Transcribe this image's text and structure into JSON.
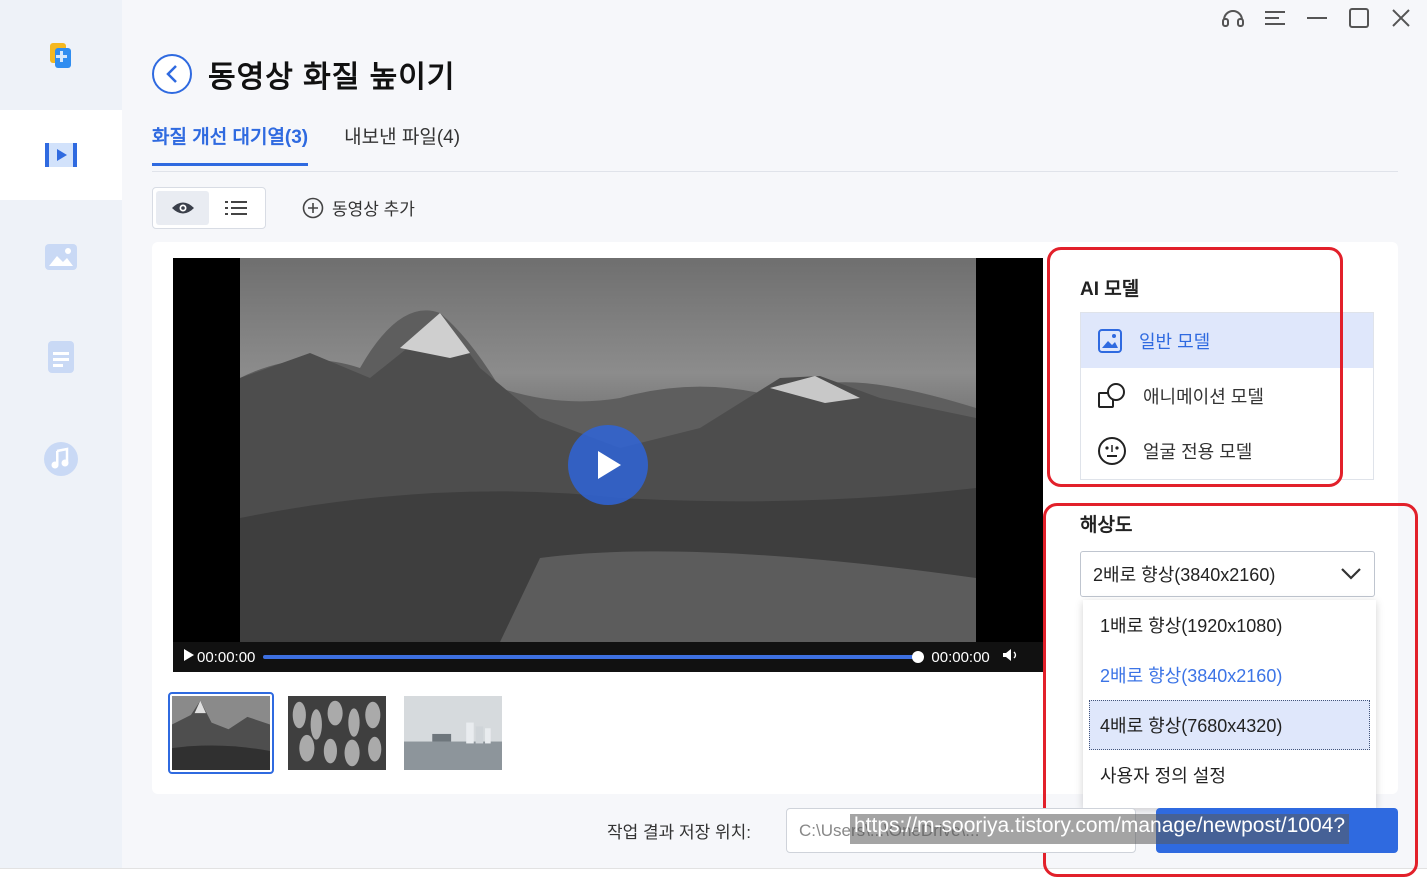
{
  "page": {
    "title": "동영상 화질 높이기"
  },
  "tabs": [
    {
      "label": "화질 개선 대기열(3)"
    },
    {
      "label": "내보낸 파일(4)"
    }
  ],
  "toolbar": {
    "add_video_label": "동영상 추가"
  },
  "video": {
    "current_time": "00:00:00",
    "duration": "00:00:00",
    "progress": 1.0
  },
  "ai_model": {
    "label": "AI 모델",
    "options": [
      {
        "label": "일반 모델",
        "icon": "image-icon",
        "selected": true
      },
      {
        "label": "애니메이션 모델",
        "icon": "shapes-icon",
        "selected": false
      },
      {
        "label": "얼굴 전용 모델",
        "icon": "face-icon",
        "selected": false
      }
    ]
  },
  "resolution": {
    "label": "해상도",
    "selected": "2배로 향상(3840x2160)",
    "options": [
      {
        "label": "1배로 향상(1920x1080)"
      },
      {
        "label": "2배로 향상(3840x2160)"
      },
      {
        "label": "4배로 향상(7680x4320)"
      },
      {
        "label": "사용자 정의 설정"
      }
    ]
  },
  "save": {
    "label": "작업 결과 저장 위치:",
    "path": "C:\\Users\\...\\OneDrive\\..."
  },
  "watermark": "https://m-sooriya.tistory.com/manage/newpost/1004?",
  "colors": {
    "accent": "#2f6ae0",
    "highlight": "#e2202a"
  }
}
